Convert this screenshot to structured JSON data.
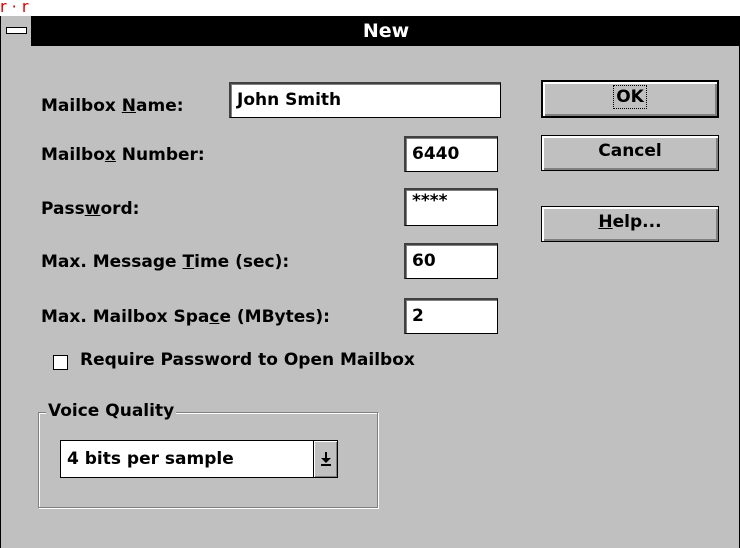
{
  "banner_text": "r  ·  r",
  "window": {
    "title": "New"
  },
  "fields": {
    "mailbox_name": {
      "label_pre": "Mailbox ",
      "label_ul": "N",
      "label_post": "ame:",
      "value": "John Smith"
    },
    "mailbox_number": {
      "label_pre": "Mailbo",
      "label_ul": "x",
      "label_post": " Number:",
      "value": "6440"
    },
    "password": {
      "label_pre": "Pass",
      "label_ul": "w",
      "label_post": "ord:",
      "value": "****"
    },
    "max_message_time": {
      "label_pre": "Max. Message ",
      "label_ul": "T",
      "label_post": "ime (sec):",
      "value": "60"
    },
    "max_mailbox_space": {
      "label_pre": "Max. Mailbox Spa",
      "label_ul": "c",
      "label_post": "e (MBytes):",
      "value": "2"
    }
  },
  "require_password": {
    "label": "Require Password to Open Mailbox",
    "checked": false
  },
  "voice_quality": {
    "label": "Voice Quality",
    "selected": "4 bits per sample"
  },
  "buttons": {
    "ok": "OK",
    "cancel": "Cancel",
    "help_ul": "H",
    "help_rest": "elp..."
  }
}
